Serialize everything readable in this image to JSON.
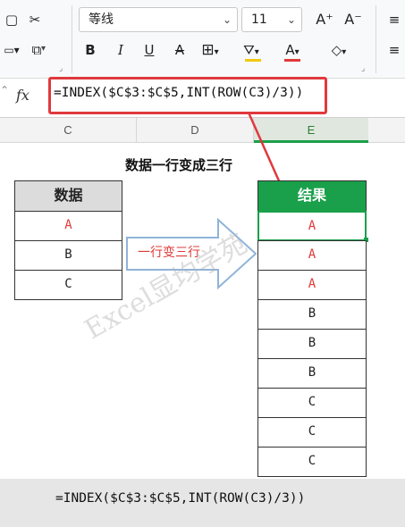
{
  "ribbon": {
    "font_name": "等线",
    "font_size": "11",
    "grow_font": "A⁺",
    "shrink_font": "A⁻",
    "bold": "B",
    "italic": "I",
    "underline": "U",
    "strike": "A",
    "font_color": "A"
  },
  "formula_bar": {
    "fx_label": "fx",
    "formula": "=INDEX($C$3:$C$5,INT(ROW(C3)/3))"
  },
  "columns": [
    "C",
    "D",
    "E"
  ],
  "title": "数据一行变成三行",
  "source_table": {
    "header": "数据",
    "values": [
      "A",
      "B",
      "C"
    ]
  },
  "arrow_label": "一行变三行",
  "result_table": {
    "header": "结果",
    "values": [
      "A",
      "A",
      "A",
      "B",
      "B",
      "B",
      "C",
      "C",
      "C"
    ]
  },
  "watermark": "Excel显均学苑",
  "bottom_formula": "=INDEX($C$3:$C$5,INT(ROW(C3)/3))",
  "colors": {
    "header_green": "#1aa04a",
    "red_text": "#e03a3a",
    "highlight_red": "#e0393e",
    "arrow_blue": "#8fb3d9"
  }
}
